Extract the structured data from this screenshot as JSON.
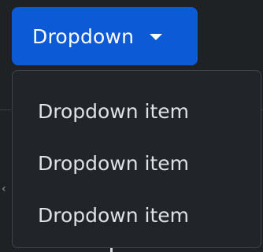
{
  "dropdown": {
    "button_label": "Dropdown",
    "caret_icon": "caret-down-icon",
    "items": [
      {
        "label": "Dropdown item"
      },
      {
        "label": "Dropdown item"
      },
      {
        "label": "Dropdown item"
      }
    ]
  },
  "colors": {
    "background": "#1f2225",
    "button": "#0d5ad6",
    "menu_background": "#212529",
    "menu_border": "#3d4349",
    "item_text": "#dee2e6"
  },
  "background_icons": {
    "left_chevron": "chevron-left-icon"
  }
}
